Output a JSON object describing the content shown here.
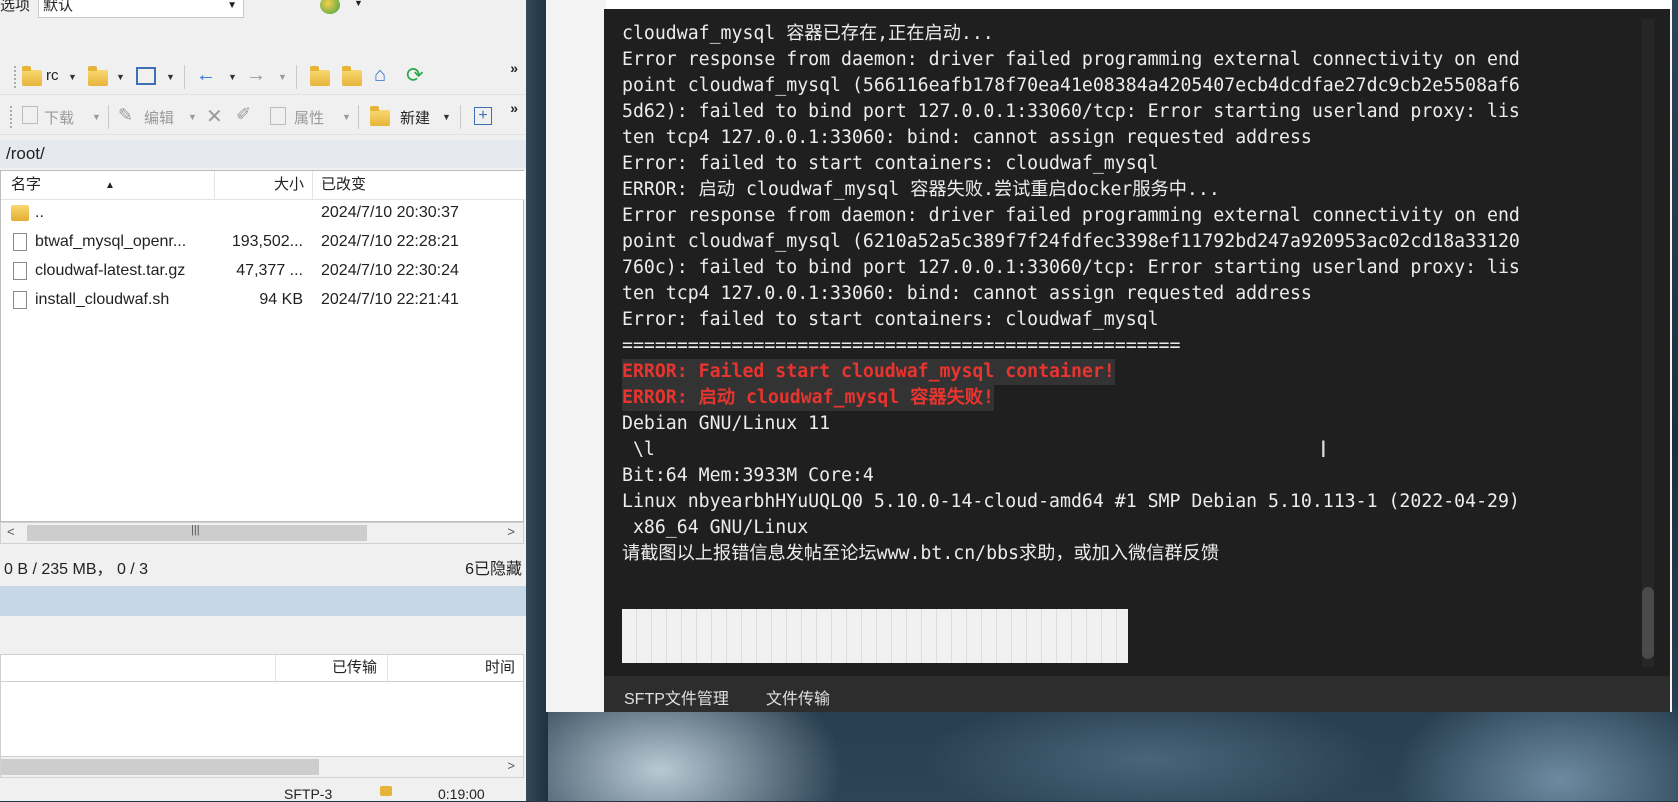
{
  "winscp": {
    "options_label": "选项",
    "options_value": "默认",
    "toolbar1": {
      "folder_label": "rc"
    },
    "toolbar2": {
      "download": "下载",
      "edit": "编辑",
      "properties": "属性",
      "new": "新建"
    },
    "path": "/root/",
    "columns": {
      "name": "名字",
      "size": "大小",
      "modified": "已改变"
    },
    "files": [
      {
        "name": "..",
        "size": "",
        "modified": "2024/7/10 20:30:37"
      },
      {
        "name": "btwaf_mysql_openr...",
        "size": "193,502...",
        "modified": "2024/7/10 22:28:21"
      },
      {
        "name": "cloudwaf-latest.tar.gz",
        "size": "47,377 ...",
        "modified": "2024/7/10 22:30:24"
      },
      {
        "name": "install_cloudwaf.sh",
        "size": "94 KB",
        "modified": "2024/7/10 22:21:41"
      }
    ],
    "status_left": "0 B / 235 MB， 0 / 3",
    "status_right": "6已隐藏",
    "transfer_columns": {
      "transferred": "已传输",
      "time": "时间"
    },
    "bottom": {
      "protocol": "SFTP-3",
      "elapsed": "0:19:00"
    }
  },
  "terminal": {
    "lines": [
      "cloudwaf_mysql 容器已存在,正在启动...",
      "Error response from daemon: driver failed programming external connectivity on end",
      "point cloudwaf_mysql (566116eafb178f70ea41e08384a4205407ecb4dcdfae27dc9cb2e5508af6",
      "5d62): failed to bind port 127.0.0.1:33060/tcp: Error starting userland proxy: lis",
      "ten tcp4 127.0.0.1:33060: bind: cannot assign requested address",
      "Error: failed to start containers: cloudwaf_mysql",
      "ERROR: 启动 cloudwaf_mysql 容器失败.尝试重启docker服务中...",
      "Error response from daemon: driver failed programming external connectivity on end",
      "point cloudwaf_mysql (6210a52a5c389f7f24fdfec3398ef11792bd247a920953ac02cd18a33120",
      "760c): failed to bind port 127.0.0.1:33060/tcp: Error starting userland proxy: lis",
      "ten tcp4 127.0.0.1:33060: bind: cannot assign requested address",
      "Error: failed to start containers: cloudwaf_mysql",
      "==================================================="
    ],
    "error_lines": [
      "ERROR: Failed start cloudwaf_mysql container!",
      "ERROR: 启动 cloudwaf_mysql 容器失败!"
    ],
    "info_lines": [
      "Debian GNU/Linux 11",
      " \\l",
      "Bit:64 Mem:3933M Core:4",
      "Linux nbyearbhHYuUQLQ0 5.10.0-14-cloud-amd64 #1 SMP Debian 5.10.113-1 (2022-04-29)",
      " x86_64 GNU/Linux",
      "请截图以上报错信息发帖至论坛www.bt.cn/bbs求助，或加入微信群反馈"
    ],
    "tabs": [
      "SFTP文件管理",
      "文件传输"
    ]
  },
  "colors": {
    "terminal_bg": "#1f1f1f",
    "error_red": "#e8342f",
    "path_bar": "#e6eaef"
  }
}
